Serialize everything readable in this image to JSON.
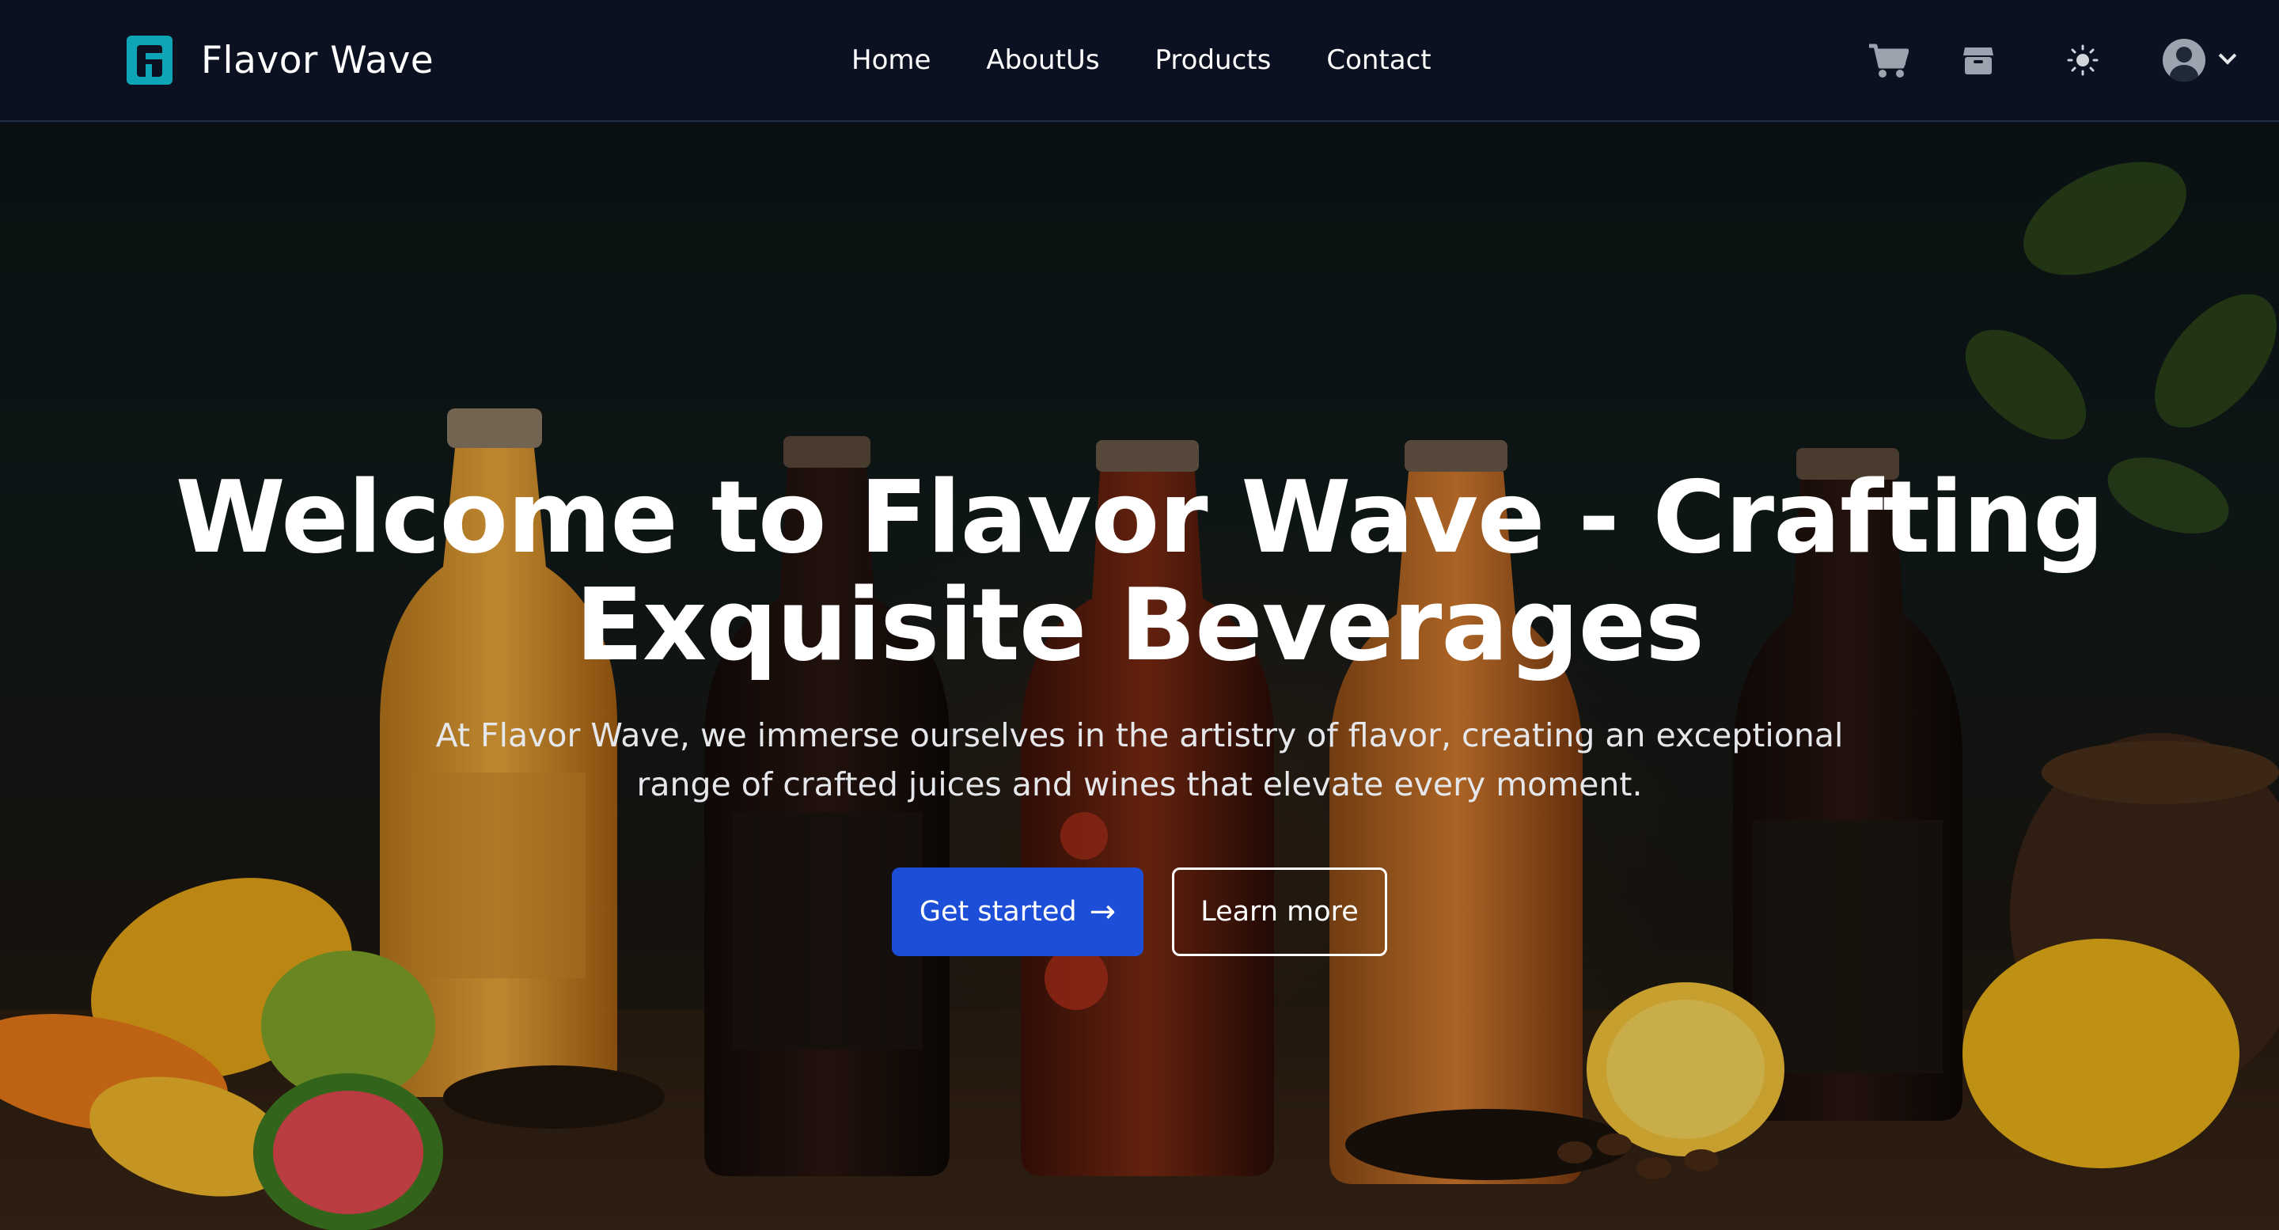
{
  "brand": {
    "name": "Flavor Wave",
    "logo_letter": "F",
    "logo_color": "#0ea5b7"
  },
  "nav": {
    "links": [
      "Home",
      "AboutUs",
      "Products",
      "Contact"
    ],
    "icons": [
      "cart-icon",
      "package-icon",
      "sun-icon",
      "user-avatar-icon",
      "chevron-down-icon"
    ]
  },
  "hero": {
    "title": "Welcome to Flavor Wave - Crafting Exquisite Beverages",
    "subtitle": "At Flavor Wave, we immerse ourselves in the artistry of flavor, creating an exceptional range of crafted juices and wines that elevate every moment.",
    "primary_button": "Get started",
    "primary_arrow": "→",
    "secondary_button": "Learn more"
  },
  "colors": {
    "navbar_bg": "#0b1120",
    "primary": "#1d4ed8",
    "text": "#ffffff"
  }
}
